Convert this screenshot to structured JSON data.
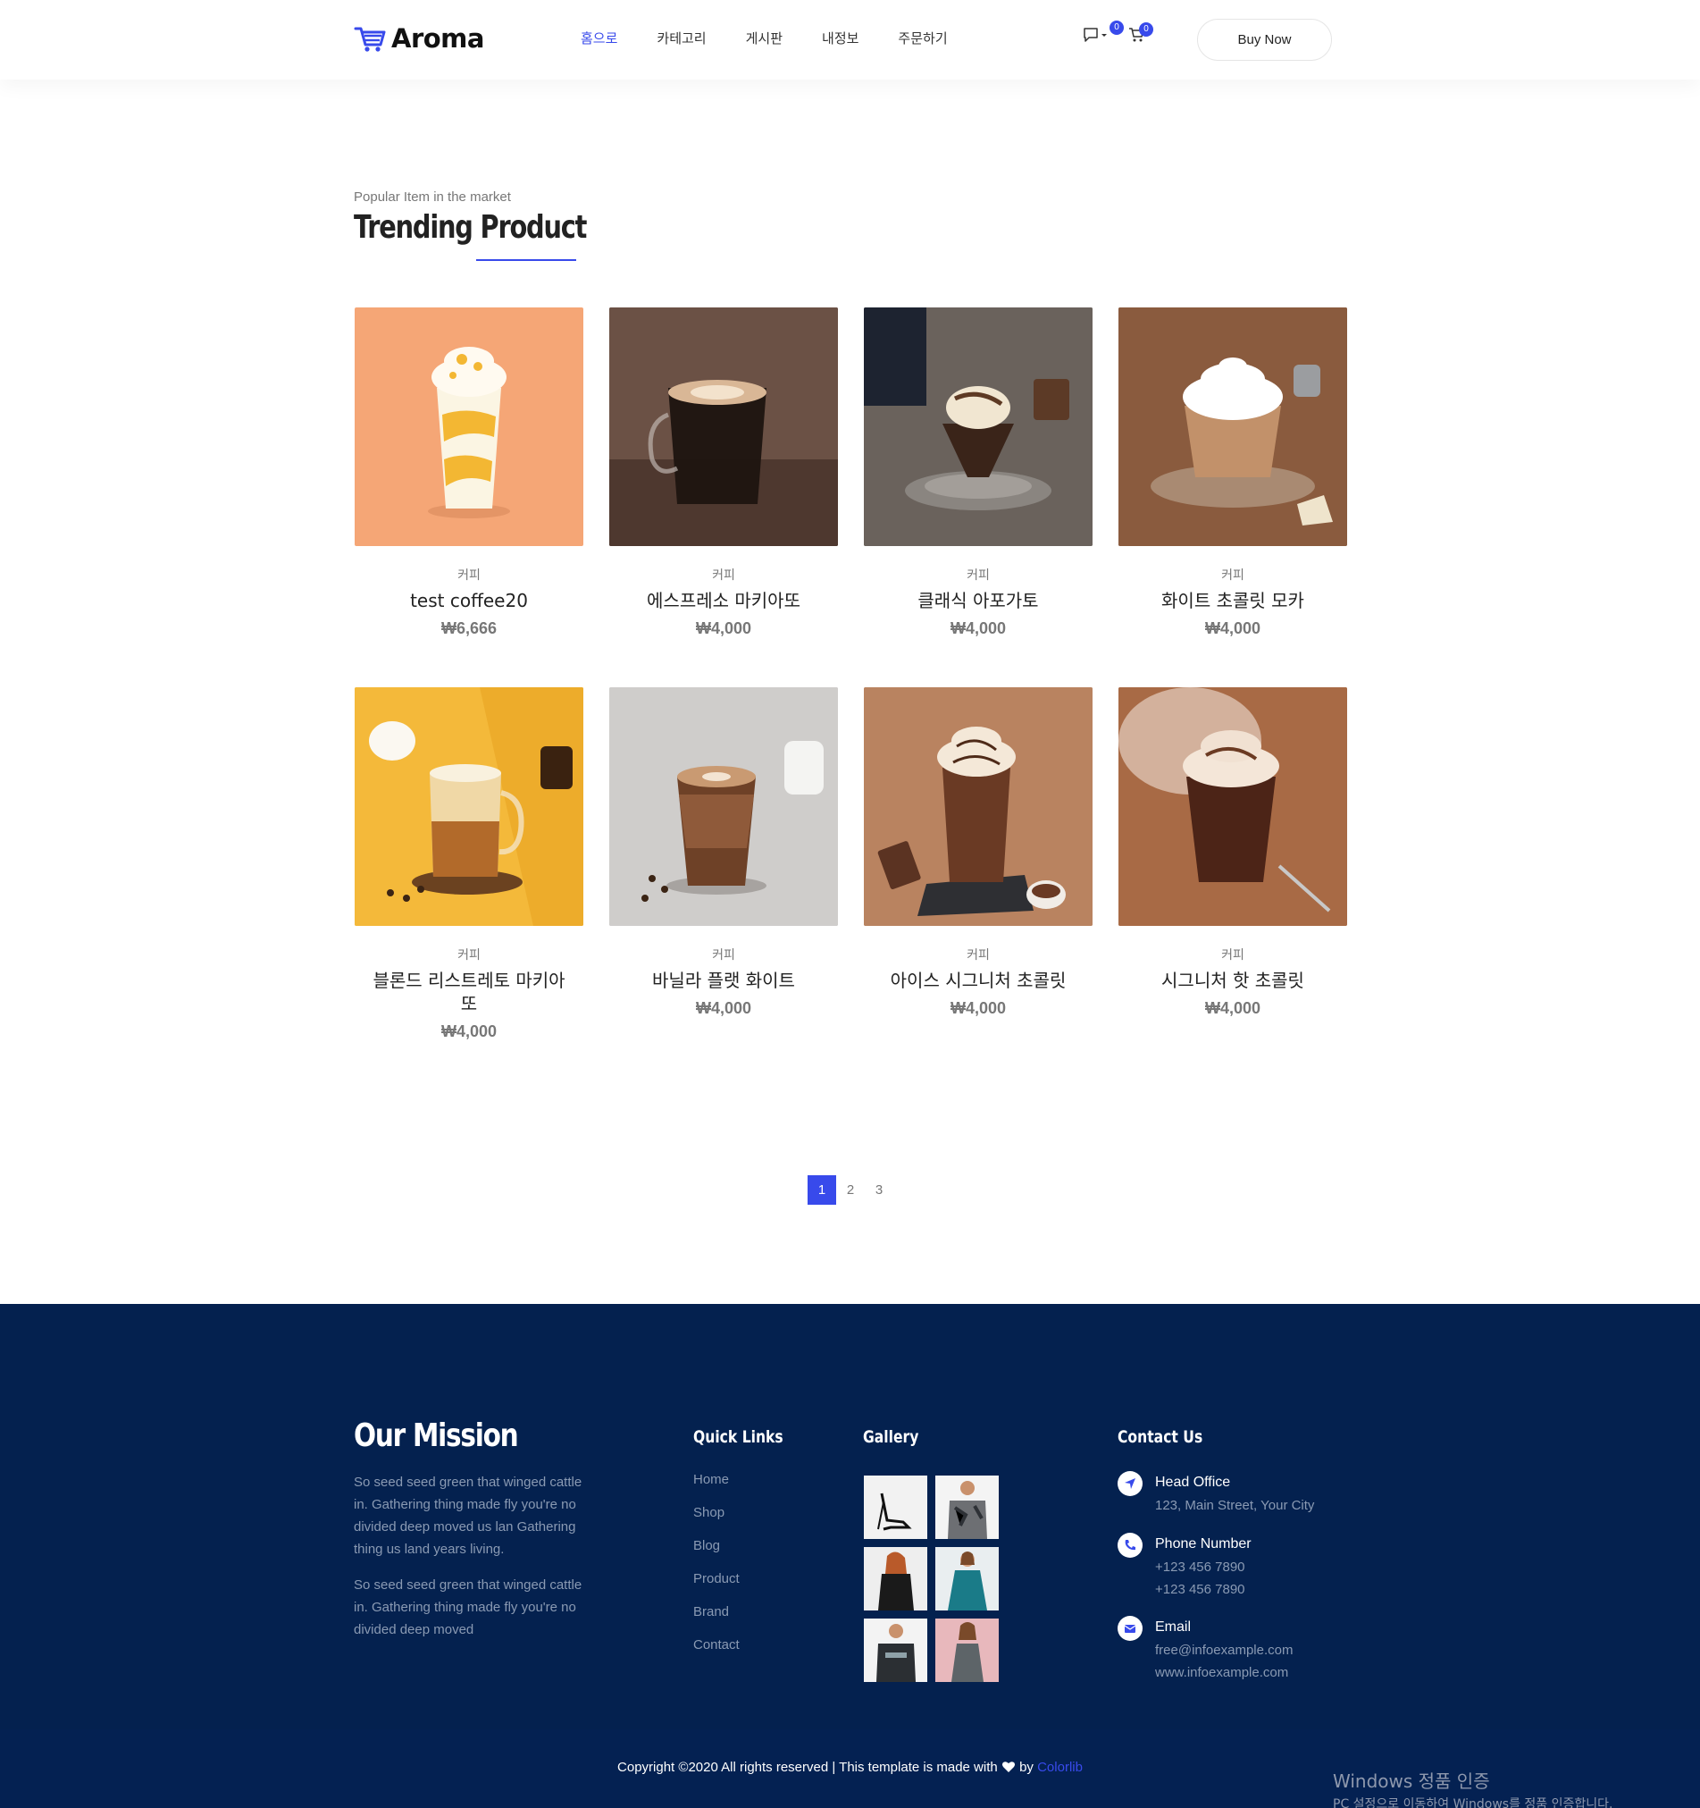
{
  "header": {
    "logo_text": "Aroma",
    "nav": [
      {
        "label": "홈으로",
        "active": true
      },
      {
        "label": "카테고리",
        "active": false
      },
      {
        "label": "게시판",
        "active": false
      },
      {
        "label": "내정보",
        "active": false
      },
      {
        "label": "주문하기",
        "active": false
      }
    ],
    "chat_badge": "0",
    "cart_badge": "0",
    "buy_now": "Buy Now"
  },
  "section": {
    "eyebrow": "Popular Item in the market",
    "title": "Trending Product"
  },
  "products": [
    {
      "category": "커피",
      "name": "test coffee20",
      "price": "₩6,666",
      "image": "yellow-frappe-photo"
    },
    {
      "category": "커피",
      "name": "에스프레소 마키아또",
      "price": "₩4,000",
      "image": "espresso-macchiato-photo"
    },
    {
      "category": "커피",
      "name": "클래식 아포가토",
      "price": "₩4,000",
      "image": "affogato-photo"
    },
    {
      "category": "커피",
      "name": "화이트 초콜릿 모카",
      "price": "₩4,000",
      "image": "white-chocolate-mocha-photo"
    },
    {
      "category": "커피",
      "name": "블론드 리스트레토 마키아또",
      "price": "₩4,000",
      "image": "blonde-ristretto-photo"
    },
    {
      "category": "커피",
      "name": "바닐라 플랫 화이트",
      "price": "₩4,000",
      "image": "vanilla-flat-white-photo"
    },
    {
      "category": "커피",
      "name": "아이스 시그니처 초콜릿",
      "price": "₩4,000",
      "image": "iced-signature-chocolate-photo"
    },
    {
      "category": "커피",
      "name": "시그니처 핫 초콜릿",
      "price": "₩4,000",
      "image": "hot-chocolate-photo"
    }
  ],
  "pagination": {
    "pages": [
      "1",
      "2",
      "3"
    ],
    "current": "1"
  },
  "footer": {
    "mission_title": "Our Mission",
    "mission_p1": "So seed seed green that winged cattle in. Gathering thing made fly you're no divided deep moved us lan Gathering thing us land years living.",
    "mission_p2": "So seed seed green that winged cattle in. Gathering thing made fly you're no divided deep moved",
    "quick_links_title": "Quick Links",
    "quick_links": [
      "Home",
      "Shop",
      "Blog",
      "Product",
      "Brand",
      "Contact"
    ],
    "gallery_title": "Gallery",
    "gallery": [
      "heels-photo",
      "camo-shirt-photo",
      "woman-black-dress-photo",
      "woman-teal-dress-photo",
      "man-jersey-photo",
      "woman-grey-top-photo"
    ],
    "contact_title": "Contact Us",
    "contact": {
      "office_label": "Head Office",
      "office_address": "123, Main Street, Your City",
      "phone_label": "Phone Number",
      "phone_1": "+123 456 7890",
      "phone_2": "+123 456 7890",
      "email_label": "Email",
      "email": "free@infoexample.com",
      "website": "www.infoexample.com"
    },
    "copyright_text": "Copyright ©2020 All rights reserved | This template is made with",
    "copyright_by": "by",
    "copyright_brand": "Colorlib"
  },
  "watermark": {
    "line1": "Windows 정품 인증",
    "line2": "PC 설정으로 이동하여 Windows를 정품 인증합니다."
  },
  "colors": {
    "accent": "#384aeb",
    "footer_bg": "#04214f",
    "muted_text": "#777777"
  }
}
